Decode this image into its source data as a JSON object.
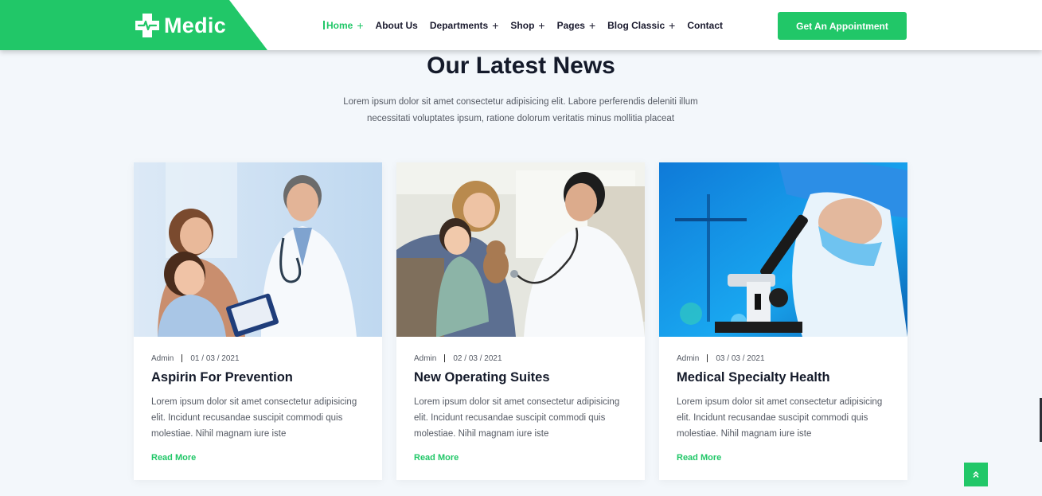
{
  "brand": {
    "name": "Medic",
    "color": "#21c768"
  },
  "nav": {
    "items": [
      {
        "label": "Home",
        "has_plus": true,
        "active": true
      },
      {
        "label": "About Us",
        "has_plus": false,
        "active": false
      },
      {
        "label": "Departments",
        "has_plus": true,
        "active": false
      },
      {
        "label": "Shop",
        "has_plus": true,
        "active": false
      },
      {
        "label": "Pages",
        "has_plus": true,
        "active": false
      },
      {
        "label": "Blog Classic",
        "has_plus": true,
        "active": false
      },
      {
        "label": "Contact",
        "has_plus": false,
        "active": false
      }
    ],
    "cta_label": "Get An Appointment",
    "plus_glyph": "+"
  },
  "section": {
    "title": "Our Latest News",
    "subtitle": "Lorem ipsum dolor sit amet consectetur adipisicing elit. Labore perferendis deleniti illum necessitati voluptates ipsum, ratione dolorum veritatis minus mollitia placeat"
  },
  "posts": [
    {
      "author": "Admin",
      "date": "01 / 03 / 2021",
      "title": "Aspirin For Prevention",
      "excerpt": "Lorem ipsum dolor sit amet consectetur adipisicing elit. Incidunt recusandae suscipit commodi quis molestiae. Nihil magnam iure iste",
      "read_more": "Read More",
      "image": "doctor-with-mother-and-daughter"
    },
    {
      "author": "Admin",
      "date": "02 / 03 / 2021",
      "title": "New Operating Suites",
      "excerpt": "Lorem ipsum dolor sit amet consectetur adipisicing elit. Incidunt recusandae suscipit commodi quis molestiae. Nihil magnam iure iste",
      "read_more": "Read More",
      "image": "doctor-examining-child"
    },
    {
      "author": "Admin",
      "date": "03 / 03 / 2021",
      "title": "Medical Specialty Health",
      "excerpt": "Lorem ipsum dolor sit amet consectetur adipisicing elit. Incidunt recusandae suscipit commodi quis molestiae. Nihil magnam iure iste",
      "read_more": "Read More",
      "image": "scientist-with-microscope"
    }
  ],
  "scroll_top_icon": "double-chevron-up-icon"
}
